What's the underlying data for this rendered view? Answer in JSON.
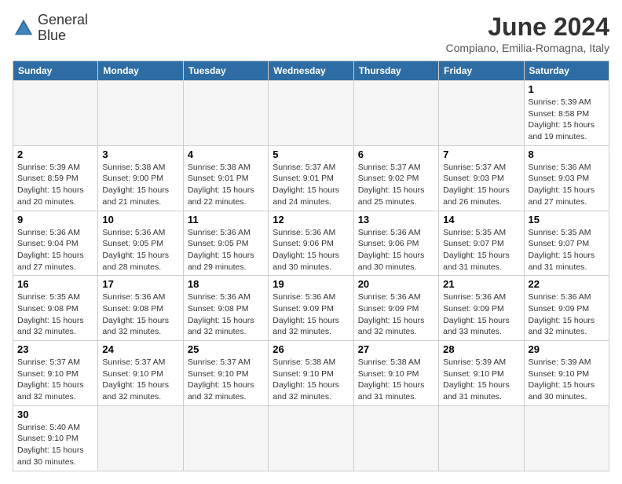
{
  "header": {
    "logo_line1": "General",
    "logo_line2": "Blue",
    "month_title": "June 2024",
    "location": "Compiano, Emilia-Romagna, Italy"
  },
  "weekdays": [
    "Sunday",
    "Monday",
    "Tuesday",
    "Wednesday",
    "Thursday",
    "Friday",
    "Saturday"
  ],
  "weeks": [
    [
      {
        "day": "",
        "empty": true
      },
      {
        "day": "",
        "empty": true
      },
      {
        "day": "",
        "empty": true
      },
      {
        "day": "",
        "empty": true
      },
      {
        "day": "",
        "empty": true
      },
      {
        "day": "",
        "empty": true
      },
      {
        "day": "1",
        "sunrise": "5:39 AM",
        "sunset": "8:58 PM",
        "daylight": "15 hours and 19 minutes."
      }
    ],
    [
      {
        "day": "2",
        "sunrise": "5:39 AM",
        "sunset": "8:59 PM",
        "daylight": "15 hours and 20 minutes."
      },
      {
        "day": "3",
        "sunrise": "5:38 AM",
        "sunset": "9:00 PM",
        "daylight": "15 hours and 21 minutes."
      },
      {
        "day": "4",
        "sunrise": "5:38 AM",
        "sunset": "9:01 PM",
        "daylight": "15 hours and 22 minutes."
      },
      {
        "day": "5",
        "sunrise": "5:37 AM",
        "sunset": "9:01 PM",
        "daylight": "15 hours and 24 minutes."
      },
      {
        "day": "6",
        "sunrise": "5:37 AM",
        "sunset": "9:02 PM",
        "daylight": "15 hours and 25 minutes."
      },
      {
        "day": "7",
        "sunrise": "5:37 AM",
        "sunset": "9:03 PM",
        "daylight": "15 hours and 26 minutes."
      },
      {
        "day": "8",
        "sunrise": "5:36 AM",
        "sunset": "9:03 PM",
        "daylight": "15 hours and 27 minutes."
      }
    ],
    [
      {
        "day": "9",
        "sunrise": "5:36 AM",
        "sunset": "9:04 PM",
        "daylight": "15 hours and 27 minutes."
      },
      {
        "day": "10",
        "sunrise": "5:36 AM",
        "sunset": "9:05 PM",
        "daylight": "15 hours and 28 minutes."
      },
      {
        "day": "11",
        "sunrise": "5:36 AM",
        "sunset": "9:05 PM",
        "daylight": "15 hours and 29 minutes."
      },
      {
        "day": "12",
        "sunrise": "5:36 AM",
        "sunset": "9:06 PM",
        "daylight": "15 hours and 30 minutes."
      },
      {
        "day": "13",
        "sunrise": "5:36 AM",
        "sunset": "9:06 PM",
        "daylight": "15 hours and 30 minutes."
      },
      {
        "day": "14",
        "sunrise": "5:35 AM",
        "sunset": "9:07 PM",
        "daylight": "15 hours and 31 minutes."
      },
      {
        "day": "15",
        "sunrise": "5:35 AM",
        "sunset": "9:07 PM",
        "daylight": "15 hours and 31 minutes."
      }
    ],
    [
      {
        "day": "16",
        "sunrise": "5:35 AM",
        "sunset": "9:08 PM",
        "daylight": "15 hours and 32 minutes."
      },
      {
        "day": "17",
        "sunrise": "5:36 AM",
        "sunset": "9:08 PM",
        "daylight": "15 hours and 32 minutes."
      },
      {
        "day": "18",
        "sunrise": "5:36 AM",
        "sunset": "9:08 PM",
        "daylight": "15 hours and 32 minutes."
      },
      {
        "day": "19",
        "sunrise": "5:36 AM",
        "sunset": "9:09 PM",
        "daylight": "15 hours and 32 minutes."
      },
      {
        "day": "20",
        "sunrise": "5:36 AM",
        "sunset": "9:09 PM",
        "daylight": "15 hours and 32 minutes."
      },
      {
        "day": "21",
        "sunrise": "5:36 AM",
        "sunset": "9:09 PM",
        "daylight": "15 hours and 33 minutes."
      },
      {
        "day": "22",
        "sunrise": "5:36 AM",
        "sunset": "9:09 PM",
        "daylight": "15 hours and 32 minutes."
      }
    ],
    [
      {
        "day": "23",
        "sunrise": "5:37 AM",
        "sunset": "9:10 PM",
        "daylight": "15 hours and 32 minutes."
      },
      {
        "day": "24",
        "sunrise": "5:37 AM",
        "sunset": "9:10 PM",
        "daylight": "15 hours and 32 minutes."
      },
      {
        "day": "25",
        "sunrise": "5:37 AM",
        "sunset": "9:10 PM",
        "daylight": "15 hours and 32 minutes."
      },
      {
        "day": "26",
        "sunrise": "5:38 AM",
        "sunset": "9:10 PM",
        "daylight": "15 hours and 32 minutes."
      },
      {
        "day": "27",
        "sunrise": "5:38 AM",
        "sunset": "9:10 PM",
        "daylight": "15 hours and 31 minutes."
      },
      {
        "day": "28",
        "sunrise": "5:39 AM",
        "sunset": "9:10 PM",
        "daylight": "15 hours and 31 minutes."
      },
      {
        "day": "29",
        "sunrise": "5:39 AM",
        "sunset": "9:10 PM",
        "daylight": "15 hours and 30 minutes."
      }
    ],
    [
      {
        "day": "30",
        "sunrise": "5:40 AM",
        "sunset": "9:10 PM",
        "daylight": "15 hours and 30 minutes."
      },
      {
        "day": "",
        "empty": true
      },
      {
        "day": "",
        "empty": true
      },
      {
        "day": "",
        "empty": true
      },
      {
        "day": "",
        "empty": true
      },
      {
        "day": "",
        "empty": true
      },
      {
        "day": "",
        "empty": true
      }
    ]
  ]
}
